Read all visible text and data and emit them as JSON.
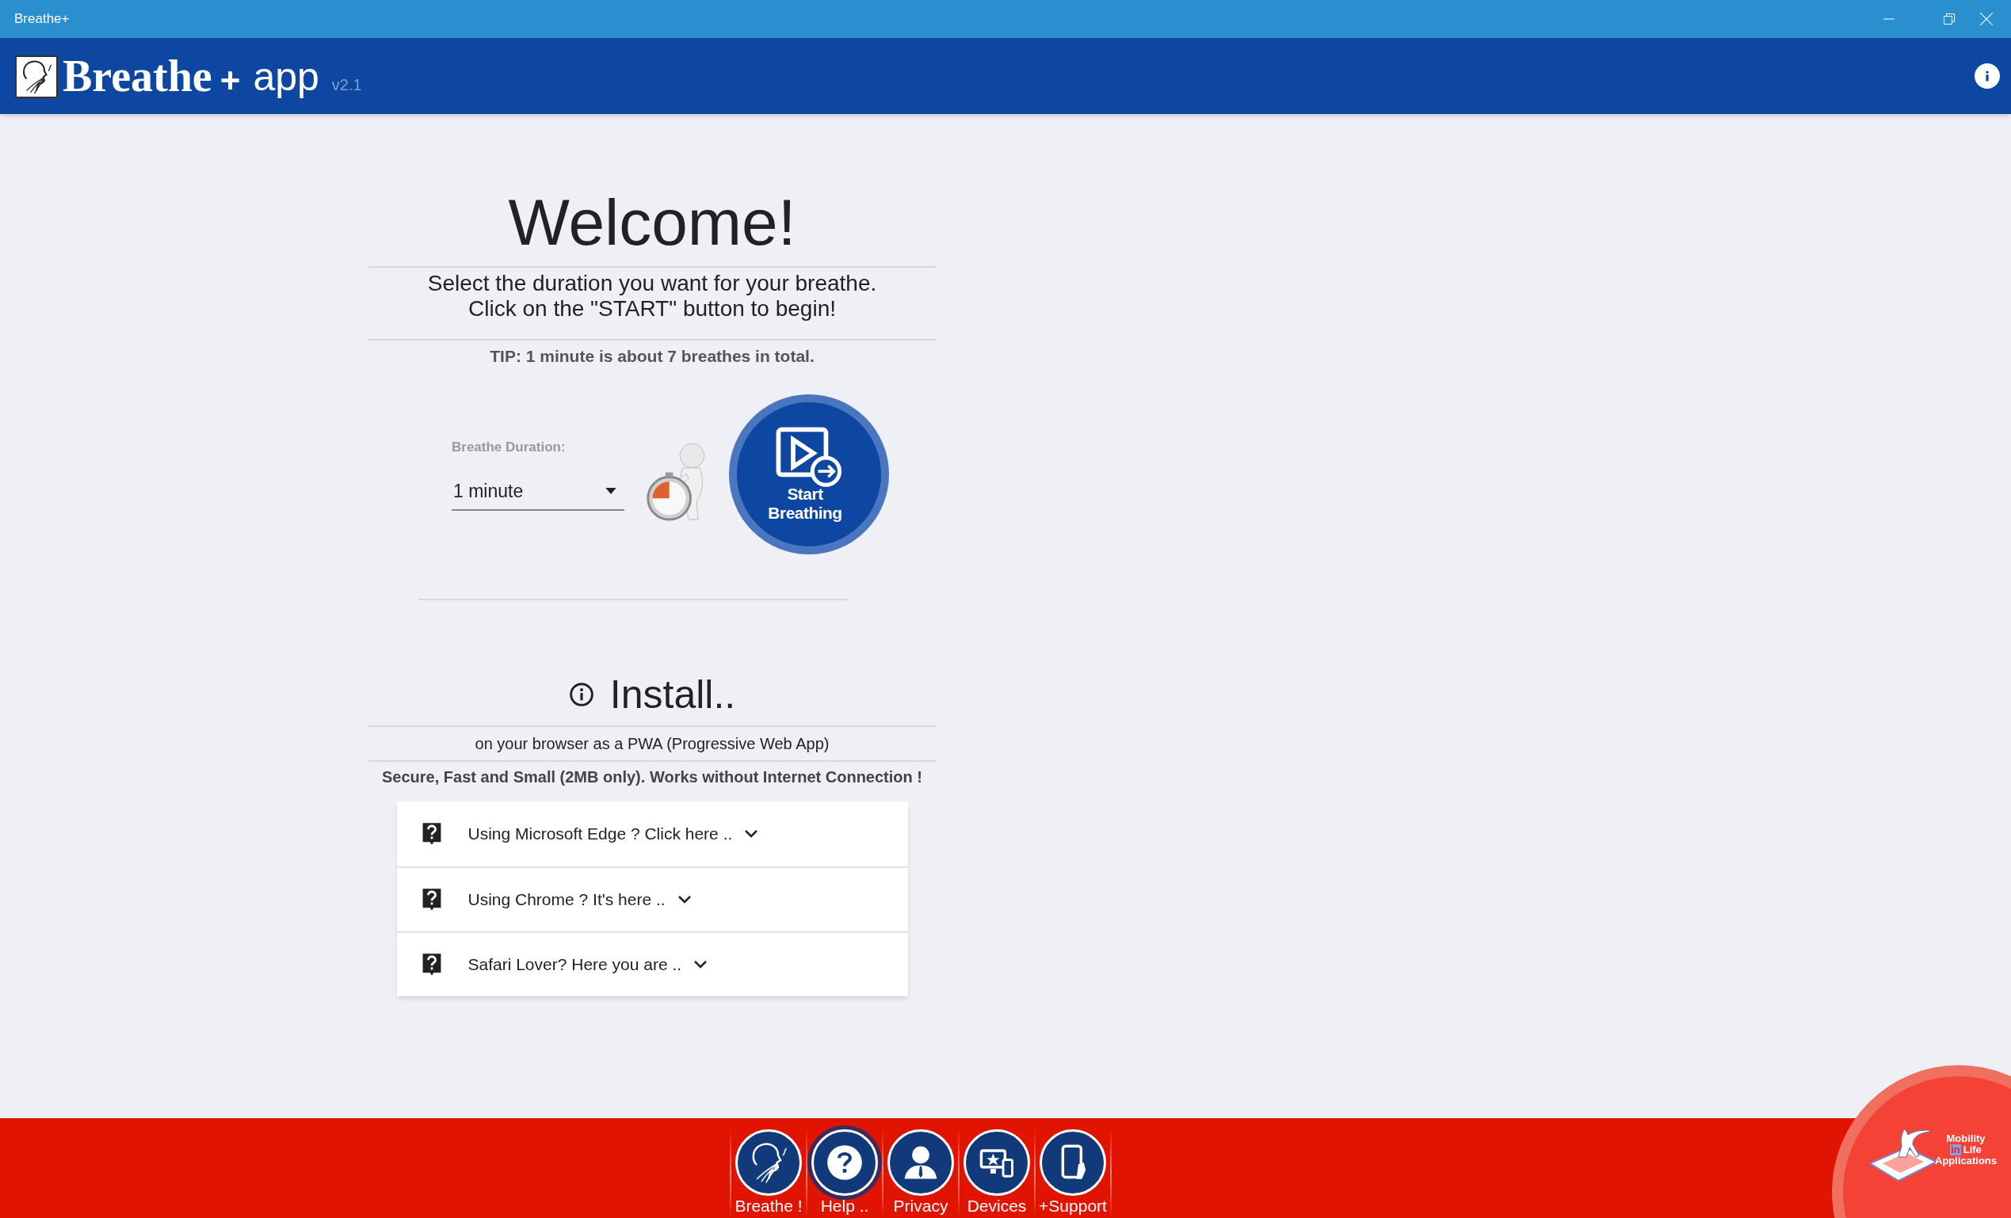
{
  "window": {
    "title": "Breathe+"
  },
  "header": {
    "logo_text": "Breathe",
    "plus": "+",
    "app": "app",
    "version": "v2.1"
  },
  "welcome": {
    "title": "Welcome!",
    "instructions": [
      "Select the duration you want for your breathe.",
      "Click on the \"START\" button to begin!"
    ],
    "tip": "TIP: 1 minute is about 7 breathes in total.",
    "duration_label": "Breathe Duration:",
    "duration_value": "1 minute",
    "start_button": [
      "Start",
      "Breathing"
    ]
  },
  "install": {
    "title": "Install..",
    "subtitle": "on your browser as a PWA (Progressive Web App)",
    "features": "Secure, Fast and Small (2MB only). Works without Internet Connection !",
    "items": [
      {
        "label": "Using Microsoft Edge ? Click here ..",
        "expanded": false
      },
      {
        "label": "Using Chrome ? It's here ..",
        "expanded": false
      },
      {
        "label": "Safari Lover? Here you are ..",
        "expanded": false
      }
    ]
  },
  "bottom_nav": [
    {
      "label": "Breathe !",
      "kind": "breathe",
      "selected": false
    },
    {
      "label": "Help ..",
      "kind": "help",
      "selected": true
    },
    {
      "label": "Privacy",
      "kind": "person",
      "selected": false
    },
    {
      "label": "Devices",
      "kind": "devices",
      "selected": false
    },
    {
      "label": "+Support",
      "kind": "phone",
      "selected": false
    }
  ],
  "brand_logo": [
    "Mobility",
    "in",
    "Life",
    "Applications"
  ]
}
